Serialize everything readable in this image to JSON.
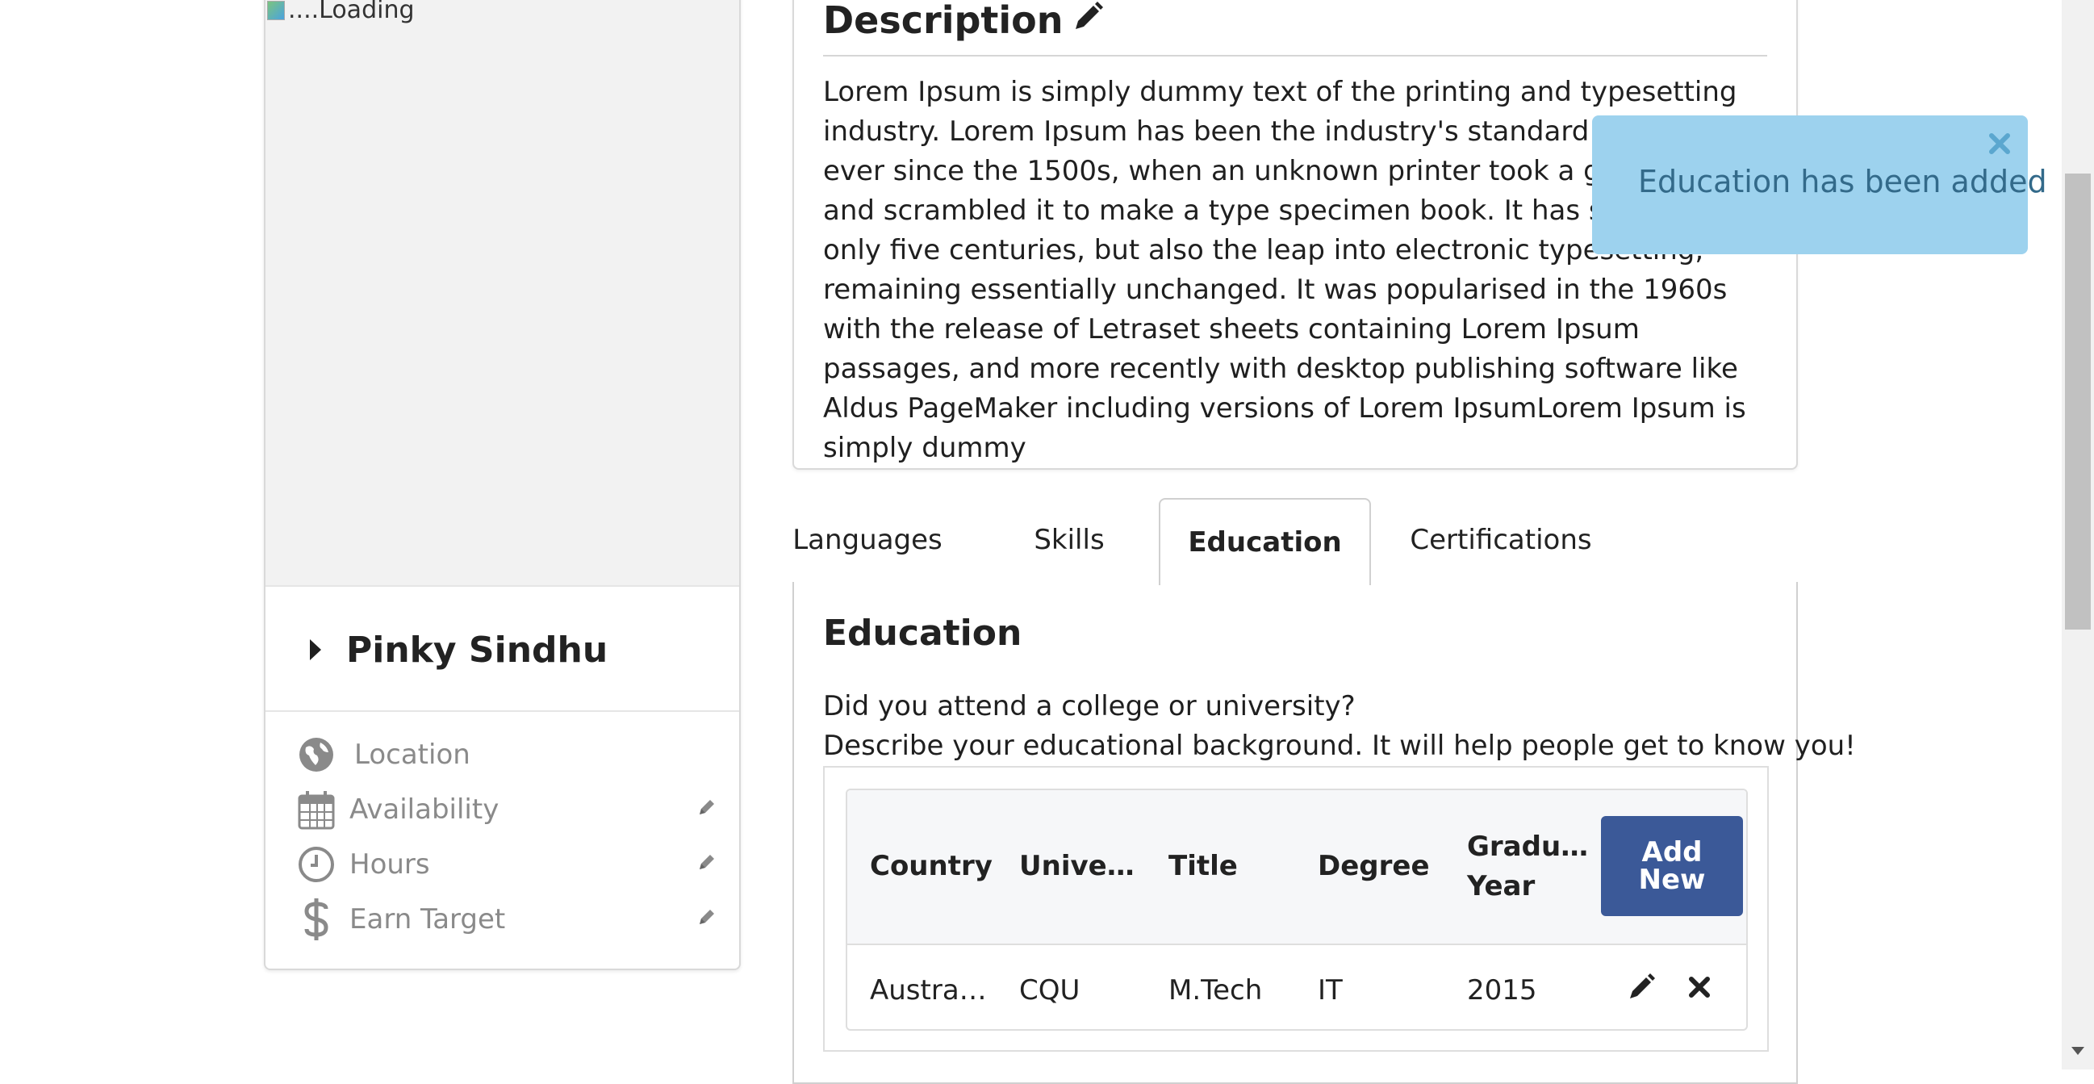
{
  "profile": {
    "photo_alt": "....Loading",
    "name": "Pinky Sindhu",
    "info_items": [
      {
        "label": "Location",
        "icon": "globe-icon"
      },
      {
        "label": "Availability",
        "icon": "calendar-icon"
      },
      {
        "label": "Hours",
        "icon": "clock-icon"
      },
      {
        "label": "Earn Target",
        "icon": "dollar-icon"
      }
    ]
  },
  "description": {
    "title": "Description",
    "text": "Lorem Ipsum is simply dummy text of the printing and typesetting industry. Lorem Ipsum has been the industry's standard dummy text ever since the 1500s, when an unknown printer took a galley of type and scrambled it to make a type specimen book. It has survived not only five centuries, but also the leap into electronic typesetting, remaining essentially unchanged. It was popularised in the 1960s with the release of Letraset sheets containing Lorem Ipsum passages, and more recently with desktop publishing software like Aldus PageMaker including versions of Lorem IpsumLorem Ipsum is simply dummy"
  },
  "tabs": [
    "Languages",
    "Skills",
    "Education",
    "Certifications"
  ],
  "active_tab": "Education",
  "education": {
    "title": "Education",
    "question": "Did you attend a college or university?",
    "hint": "Describe your educational background. It will help people get to know you!",
    "columns": [
      "Country",
      "Unive…",
      "Title",
      "Degree",
      "Gradu…",
      "Year"
    ],
    "add_button": "Add New",
    "rows": [
      {
        "country": "Austra…",
        "university": "CQU",
        "title": "M.Tech",
        "degree": "IT",
        "year": "2015"
      }
    ]
  },
  "toast": {
    "message": "Education has been added"
  },
  "colors": {
    "accent_button": "#3b5998",
    "toast_bg": "#9dd2ee",
    "toast_text": "#336a8a"
  }
}
